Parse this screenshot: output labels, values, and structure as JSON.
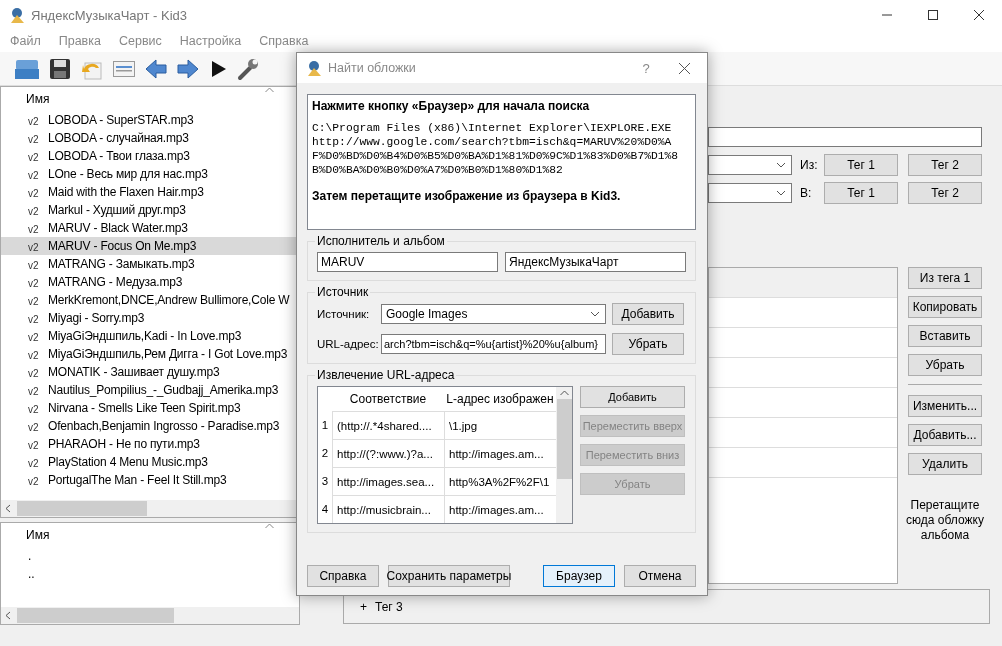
{
  "window": {
    "title": "ЯндексМузыкаЧарт - Kid3"
  },
  "menu": [
    "Файл",
    "Правка",
    "Сервис",
    "Настройка",
    "Справка"
  ],
  "file_list": {
    "header": "Имя",
    "rows": [
      {
        "tag": "v2",
        "name": "LOBODA - SuperSTAR.mp3",
        "selected": false
      },
      {
        "tag": "v2",
        "name": "LOBODA - случайная.mp3",
        "selected": false
      },
      {
        "tag": "v2",
        "name": "LOBODA - Твои глаза.mp3",
        "selected": false
      },
      {
        "tag": "v2",
        "name": "LOne - Весь мир для нас.mp3",
        "selected": false
      },
      {
        "tag": "v2",
        "name": "Maid with the Flaxen Hair.mp3",
        "selected": false
      },
      {
        "tag": "v2",
        "name": "Markul - Худший друг.mp3",
        "selected": false
      },
      {
        "tag": "v2",
        "name": "MARUV - Black Water.mp3",
        "selected": false
      },
      {
        "tag": "v2",
        "name": "MARUV - Focus On Me.mp3",
        "selected": true
      },
      {
        "tag": "v2",
        "name": "MATRANG - Замыкать.mp3",
        "selected": false
      },
      {
        "tag": "v2",
        "name": "MATRANG - Медуза.mp3",
        "selected": false
      },
      {
        "tag": "v2",
        "name": "MerkKremont,DNCE,Andrew Bullimore,Cole W",
        "selected": false
      },
      {
        "tag": "v2",
        "name": "Miyagi - Sorry.mp3",
        "selected": false
      },
      {
        "tag": "v2",
        "name": "MiyaGiЭндшпиль,Kadi - In Love.mp3",
        "selected": false
      },
      {
        "tag": "v2",
        "name": "MiyaGiЭндшпиль,Рем Дигга - I Got Love.mp3",
        "selected": false
      },
      {
        "tag": "v2",
        "name": "MONATIK - Зашивает душу.mp3",
        "selected": false
      },
      {
        "tag": "v2",
        "name": "Nautilus_Pompilius_-_Gudbajj_Amerika.mp3",
        "selected": false
      },
      {
        "tag": "v2",
        "name": "Nirvana - Smells Like Teen Spirit.mp3",
        "selected": false
      },
      {
        "tag": "v2",
        "name": "Ofenbach,Benjamin Ingrosso - Paradise.mp3",
        "selected": false
      },
      {
        "tag": "v2",
        "name": "PHARAOH - Не по пути.mp3",
        "selected": false
      },
      {
        "tag": "v2",
        "name": "PlayStation 4 Menu Music.mp3",
        "selected": false
      },
      {
        "tag": "v2",
        "name": "PortugalThe Man - Feel It Still.mp3",
        "selected": false
      }
    ]
  },
  "dir_list": {
    "header": "Имя",
    "rows": [
      ".",
      ".."
    ]
  },
  "tag_panel": {
    "copy_rows": [
      {
        "label": "Из:",
        "buttons": [
          "Тег 1",
          "Тег 2"
        ]
      },
      {
        "label": "В:",
        "buttons": [
          "Тег 1",
          "Тег 2"
        ]
      }
    ],
    "side_buttons": [
      "Из тега 1",
      "Копировать",
      "Вставить",
      "Убрать"
    ],
    "edit_buttons": [
      "Изменить...",
      "Добавить...",
      "Удалить"
    ],
    "drop_hint": "Перетащите сюда обложку альбома"
  },
  "tag3": {
    "expander": "+",
    "label": "Тег 3"
  },
  "dialog": {
    "title": "Найти обложки",
    "help": "?",
    "instructions": {
      "heading": "Нажмите кнопку «Браузер» для начала поиска",
      "path": "C:\\Program Files (x86)\\Internet Explorer\\IEXPLORE.EXE",
      "url": "http://www.google.com/search?tbm=isch&q=MARUV%20%D0%AF%D0%BD%D0%B4%D0%B5%D0%BA%D1%81%D0%9C%D1%83%D0%B7%D1%8B%D0%BA%D0%B0%D0%A7%D0%B0%D1%80%D1%82",
      "footer": "Затем перетащите изображение из браузера в Kid3."
    },
    "artist_album": {
      "title": "Исполнитель и альбом",
      "artist": "MARUV",
      "album": "ЯндексМузыкаЧарт"
    },
    "source": {
      "title": "Источник",
      "source_label": "Источник:",
      "source_value": "Google Images",
      "add_button": "Добавить",
      "url_label": "URL-адрес:",
      "url_value": "arch?tbm=isch&q=%u{artist}%20%u{album}",
      "remove_button": "Убрать"
    },
    "extraction": {
      "title": "Извлечение URL-адреса",
      "columns": [
        "Соответствие",
        "L-адрес изображен"
      ],
      "rows": [
        {
          "number": "1",
          "cells": [
            "(http://.*4shared....",
            "\\1.jpg"
          ]
        },
        {
          "number": "2",
          "cells": [
            "http://(?:www.)?a...",
            "http://images.am..."
          ]
        },
        {
          "number": "3",
          "cells": [
            "http://images.sea...",
            "http%3A%2F%2F\\1"
          ]
        },
        {
          "number": "4",
          "cells": [
            "http://musicbrain...",
            "http://images.am..."
          ]
        }
      ],
      "buttons": [
        {
          "label": "Добавить",
          "disabled": false
        },
        {
          "label": "Переместить вверх",
          "disabled": true
        },
        {
          "label": "Переместить вниз",
          "disabled": true
        },
        {
          "label": "Убрать",
          "disabled": true
        }
      ]
    },
    "buttons": [
      {
        "label": "Справка",
        "default": false
      },
      {
        "label": "Сохранить параметры",
        "default": false
      },
      {
        "label": "Браузер",
        "default": true
      },
      {
        "label": "Отмена",
        "default": false
      }
    ]
  }
}
